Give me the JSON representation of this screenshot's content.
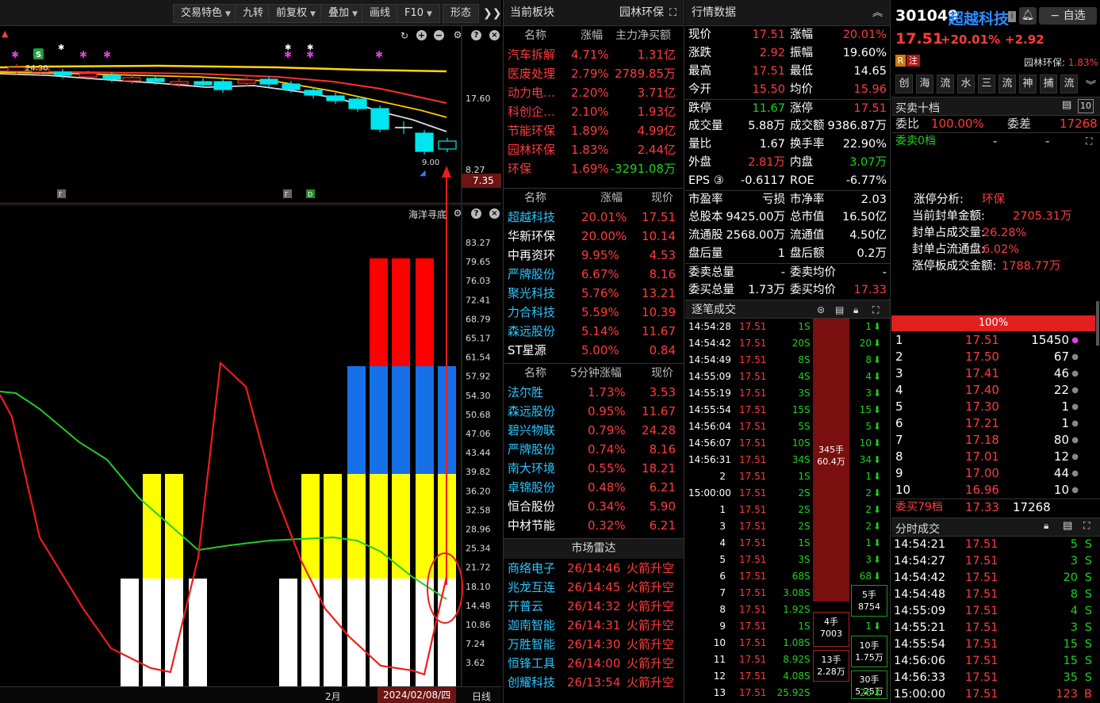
{
  "toolbar": {
    "items": [
      "交易特色",
      "九转",
      "前复权",
      "叠加",
      "画线",
      "F10",
      "形态"
    ]
  },
  "main_chart": {
    "price_labels": [
      "17.60",
      "8.27"
    ],
    "current_price_tag": "7.35",
    "high_label": "24.30",
    "low_label": "9.00",
    "markers": [
      "S"
    ],
    "flag_labels": [
      "Γ",
      "Γ",
      "D"
    ]
  },
  "sub_chart": {
    "indicator_name": "海洋寻底",
    "scale": [
      "83.27",
      "79.65",
      "76.03",
      "72.41",
      "68.79",
      "65.17",
      "61.54",
      "57.92",
      "54.30",
      "50.68",
      "47.06",
      "43.44",
      "39.82",
      "36.20",
      "32.58",
      "28.96",
      "25.34",
      "21.72",
      "18.10",
      "14.48",
      "10.86",
      "7.24",
      "3.62"
    ]
  },
  "xaxis": {
    "month": "2月",
    "date": "2024/02/08/四",
    "period": "日线"
  },
  "sector_panel": {
    "title": "当前板块",
    "sector": "园林环保",
    "headers": [
      "名称",
      "涨幅",
      "主力净买额"
    ],
    "rows": [
      {
        "name": "汽车拆解",
        "chg": "4.71%",
        "flow": "1.31亿"
      },
      {
        "name": "医废处理",
        "chg": "2.79%",
        "flow": "2789.85万"
      },
      {
        "name": "动力电…",
        "chg": "2.20%",
        "flow": "3.71亿"
      },
      {
        "name": "科创企…",
        "chg": "2.10%",
        "flow": "1.93亿"
      },
      {
        "name": "节能环保",
        "chg": "1.89%",
        "flow": "4.99亿"
      },
      {
        "name": "园林环保",
        "chg": "1.83%",
        "flow": "2.44亿"
      },
      {
        "name": "环保",
        "chg": "1.69%",
        "flow": "-3291.08万"
      }
    ]
  },
  "stock_panel": {
    "headers": [
      "名称",
      "涨幅",
      "现价"
    ],
    "rows": [
      {
        "name": "超越科技",
        "chg": "20.01%",
        "price": "17.51"
      },
      {
        "name": "华新环保",
        "chg": "20.00%",
        "price": "10.14"
      },
      {
        "name": "中再资环",
        "chg": "9.95%",
        "price": "4.53"
      },
      {
        "name": "严牌股份",
        "chg": "6.67%",
        "price": "8.16"
      },
      {
        "name": "聚光科技",
        "chg": "5.76%",
        "price": "13.21"
      },
      {
        "name": "力合科技",
        "chg": "5.59%",
        "price": "10.39"
      },
      {
        "name": "森远股份",
        "chg": "5.14%",
        "price": "11.67"
      },
      {
        "name": "ST星源",
        "chg": "5.00%",
        "price": "0.84"
      }
    ]
  },
  "fivemin_panel": {
    "headers": [
      "名称",
      "5分钟涨幅",
      "现价"
    ],
    "rows": [
      {
        "name": "法尔胜",
        "chg": "1.73%",
        "price": "3.53"
      },
      {
        "name": "森远股份",
        "chg": "0.95%",
        "price": "11.67"
      },
      {
        "name": "碧兴物联",
        "chg": "0.79%",
        "price": "24.28"
      },
      {
        "name": "严牌股份",
        "chg": "0.74%",
        "price": "8.16"
      },
      {
        "name": "南大环境",
        "chg": "0.55%",
        "price": "18.21"
      },
      {
        "name": "卓锦股份",
        "chg": "0.48%",
        "price": "6.21"
      },
      {
        "name": "恒合股份",
        "chg": "0.34%",
        "price": "5.90"
      },
      {
        "name": "中材节能",
        "chg": "0.32%",
        "price": "6.21"
      }
    ]
  },
  "radar_panel": {
    "title": "市场雷达",
    "rows": [
      {
        "name": "商络电子",
        "time": "26/14:46",
        "event": "火箭升空"
      },
      {
        "name": "兆龙互连",
        "time": "26/14:45",
        "event": "火箭升空"
      },
      {
        "name": "开普云",
        "time": "26/14:32",
        "event": "火箭升空"
      },
      {
        "name": "迦南智能",
        "time": "26/14:31",
        "event": "火箭升空"
      },
      {
        "name": "万胜智能",
        "time": "26/14:30",
        "event": "火箭升空"
      },
      {
        "name": "恒锋工具",
        "time": "26/14:00",
        "event": "火箭升空"
      },
      {
        "name": "创耀科技",
        "time": "26/13:54",
        "event": "火箭升空"
      }
    ]
  },
  "quote_panel": {
    "title": "行情数据",
    "rows": [
      {
        "l1": "现价",
        "v1": "17.51",
        "l2": "涨幅",
        "v2": "20.01%"
      },
      {
        "l1": "涨跌",
        "v1": "2.92",
        "l2": "振幅",
        "v2": "19.60%"
      },
      {
        "l1": "最高",
        "v1": "17.51",
        "l2": "最低",
        "v2": "14.65"
      },
      {
        "l1": "今开",
        "v1": "15.50",
        "l2": "均价",
        "v2": "15.96"
      },
      {
        "l1": "跌停",
        "v1": "11.67",
        "l2": "涨停",
        "v2": "17.51"
      },
      {
        "l1": "成交量",
        "v1": "5.88万",
        "l2": "成交额",
        "v2": "9386.87万"
      },
      {
        "l1": "量比",
        "v1": "1.67",
        "l2": "换手率",
        "v2": "22.90%"
      },
      {
        "l1": "外盘",
        "v1": "2.81万",
        "l2": "内盘",
        "v2": "3.07万"
      },
      {
        "l1": "EPS ③",
        "v1": "-0.6117",
        "l2": "ROE",
        "v2": "-6.77%"
      },
      {
        "l1": "市盈率",
        "v1": "亏损",
        "l2": "市净率",
        "v2": "2.03"
      },
      {
        "l1": "总股本",
        "v1": "9425.00万",
        "l2": "总市值",
        "v2": "16.50亿"
      },
      {
        "l1": "流通股",
        "v1": "2568.00万",
        "l2": "流通值",
        "v2": "4.50亿"
      },
      {
        "l1": "盘后量",
        "v1": "1",
        "l2": "盘后额",
        "v2": "0.2万"
      },
      {
        "l1": "委卖总量",
        "v1": "-",
        "l2": "委卖均价",
        "v2": "-"
      },
      {
        "l1": "委买总量",
        "v1": "1.73万",
        "l2": "委买均价",
        "v2": "17.33"
      }
    ]
  },
  "ticks_panel": {
    "title": "逐笔成交",
    "rows": [
      {
        "t": "14:54:28",
        "p": "17.51",
        "v": "1",
        "s": "S"
      },
      {
        "t": "14:54:42",
        "p": "17.51",
        "v": "20",
        "s": "S"
      },
      {
        "t": "14:54:49",
        "p": "17.51",
        "v": "8",
        "s": "S"
      },
      {
        "t": "14:55:09",
        "p": "17.51",
        "v": "4",
        "s": "S"
      },
      {
        "t": "14:55:19",
        "p": "17.51",
        "v": "3",
        "s": "S"
      },
      {
        "t": "14:55:54",
        "p": "17.51",
        "v": "15",
        "s": "S"
      },
      {
        "t": "14:56:04",
        "p": "17.51",
        "v": "5",
        "s": "S"
      },
      {
        "t": "14:56:07",
        "p": "17.51",
        "v": "10",
        "s": "S"
      },
      {
        "t": "14:56:31",
        "p": "17.51",
        "v": "34",
        "s": "S"
      },
      {
        "t": "2",
        "p": "17.51",
        "v": "1",
        "s": "S"
      },
      {
        "t": "15:00:00",
        "p": "17.51",
        "v": "2",
        "s": "S"
      },
      {
        "t": "1",
        "p": "17.51",
        "v": "2",
        "s": "S"
      },
      {
        "t": "3",
        "p": "17.51",
        "v": "2",
        "s": "S"
      },
      {
        "t": "4",
        "p": "17.51",
        "v": "1",
        "s": "S"
      },
      {
        "t": "5",
        "p": "17.51",
        "v": "3",
        "s": "S"
      },
      {
        "t": "6",
        "p": "17.51",
        "v": "68",
        "s": "S"
      },
      {
        "t": "7",
        "p": "17.51",
        "v": "3.08",
        "s": "S"
      },
      {
        "t": "8",
        "p": "17.51",
        "v": "1.92",
        "s": "S"
      },
      {
        "t": "9",
        "p": "17.51",
        "v": "1",
        "s": "S"
      },
      {
        "t": "10",
        "p": "17.51",
        "v": "1.08",
        "s": "S"
      },
      {
        "t": "11",
        "p": "17.51",
        "v": "8.92",
        "s": "S"
      },
      {
        "t": "12",
        "p": "17.51",
        "v": "4.08",
        "s": "S"
      },
      {
        "t": "13",
        "p": "17.51",
        "v": "25.92",
        "s": "S"
      }
    ],
    "right_col": [
      "1",
      "20",
      "8",
      "4",
      "3",
      "15",
      "5",
      "10",
      "34",
      "1",
      "2",
      "2",
      "2",
      "1",
      "3",
      "68",
      "5手",
      "8754",
      "1",
      "10手",
      "1.75万",
      "30手",
      "26"
    ],
    "big_block": {
      "lots": "345手",
      "amount": "60.4万"
    },
    "small_blocks": [
      {
        "lots": "4手",
        "amount": "7003"
      },
      {
        "lots": "13手",
        "amount": "2.28万"
      }
    ],
    "right_blocks": [
      {
        "lots": "5手",
        "amount": "8754"
      },
      {
        "lots": "10手",
        "amount": "1.75万"
      },
      {
        "lots": "30手",
        "amount": "5.25万"
      }
    ]
  },
  "stock_header": {
    "code": "301049",
    "name": "超越科技",
    "price": "17.51",
    "pct": "+20.01%",
    "chg": "+2.92",
    "tag_r": "R",
    "tag_zhu": "注",
    "sector_name": "园林环保:",
    "sector_pct": "1.83%",
    "watchlist": "自选",
    "buttons": [
      "创",
      "海",
      "流",
      "水",
      "三",
      "流",
      "神",
      "捕",
      "流"
    ]
  },
  "orderbook": {
    "title": "买卖十档",
    "wb_label": "委比",
    "wb_value": "100.00%",
    "wc_label": "委差",
    "wc_value": "17268",
    "sell_label": "委卖0档",
    "sell_dash1": "-",
    "sell_dash2": "-",
    "limit_analysis": [
      {
        "k": "涨停分析:",
        "v": "环保"
      },
      {
        "k": "当前封单金额:",
        "v": "2705.31万"
      },
      {
        "k": "封单占成交量:",
        "v": "26.28%"
      },
      {
        "k": "封单占流通盘:",
        "v": "6.02%"
      },
      {
        "k": "涨停板成交金额:",
        "v": "1788.77万"
      }
    ],
    "pct_bar": "100%",
    "bids": [
      {
        "lvl": "1",
        "p": "17.51",
        "v": "15450"
      },
      {
        "lvl": "2",
        "p": "17.50",
        "v": "67"
      },
      {
        "lvl": "3",
        "p": "17.41",
        "v": "46"
      },
      {
        "lvl": "4",
        "p": "17.40",
        "v": "22"
      },
      {
        "lvl": "5",
        "p": "17.30",
        "v": "1"
      },
      {
        "lvl": "6",
        "p": "17.21",
        "v": "1"
      },
      {
        "lvl": "7",
        "p": "17.18",
        "v": "80"
      },
      {
        "lvl": "8",
        "p": "17.01",
        "v": "12"
      },
      {
        "lvl": "9",
        "p": "17.00",
        "v": "44"
      },
      {
        "lvl": "10",
        "p": "16.96",
        "v": "10"
      }
    ],
    "buy_label": "委买79档",
    "buy_avg": "17.33",
    "buy_total": "17268"
  },
  "timesales": {
    "title": "分时成交",
    "rows": [
      {
        "t": "14:54:21",
        "p": "17.51",
        "v": "5",
        "s": "S"
      },
      {
        "t": "14:54:27",
        "p": "17.51",
        "v": "3",
        "s": "S"
      },
      {
        "t": "14:54:42",
        "p": "17.51",
        "v": "20",
        "s": "S"
      },
      {
        "t": "14:54:48",
        "p": "17.51",
        "v": "8",
        "s": "S"
      },
      {
        "t": "14:55:09",
        "p": "17.51",
        "v": "4",
        "s": "S"
      },
      {
        "t": "14:55:21",
        "p": "17.51",
        "v": "3",
        "s": "S"
      },
      {
        "t": "14:55:54",
        "p": "17.51",
        "v": "15",
        "s": "S"
      },
      {
        "t": "14:56:06",
        "p": "17.51",
        "v": "15",
        "s": "S"
      },
      {
        "t": "14:56:33",
        "p": "17.51",
        "v": "35",
        "s": "S"
      },
      {
        "t": "15:00:00",
        "p": "17.51",
        "v": "123",
        "s": "B"
      }
    ]
  },
  "colors": {
    "up": "#ff3b3b",
    "down": "#1ed21e",
    "link": "#2cc6ff",
    "bg": "#000000",
    "panel_header": "#181818"
  }
}
